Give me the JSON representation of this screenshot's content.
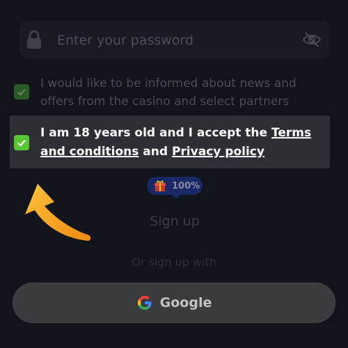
{
  "password": {
    "placeholder": "Enter your password",
    "lock_icon": "lock-icon",
    "toggle_icon": "eye-slash-icon"
  },
  "consents": {
    "news": {
      "checked": true,
      "text": "I would like to be informed about news and offers from the casino and select partners"
    },
    "age": {
      "checked": true,
      "text_part1": "I am 18 years old and I accept the ",
      "terms_link": "Terms and conditions",
      "text_part2": " and ",
      "privacy_link": "Privacy policy"
    }
  },
  "bonus_badge": {
    "icon": "gift-icon",
    "value": "100%"
  },
  "signup": {
    "label": "Sign up"
  },
  "alt_signup": {
    "text": "Or sign up with",
    "google_label": "Google",
    "google_icon": "google-icon"
  },
  "colors": {
    "background": "#12141b",
    "check_active": "#58c630",
    "highlight": "#2d2f35",
    "badge": "#1a2868",
    "arrow": "#f5a623"
  }
}
